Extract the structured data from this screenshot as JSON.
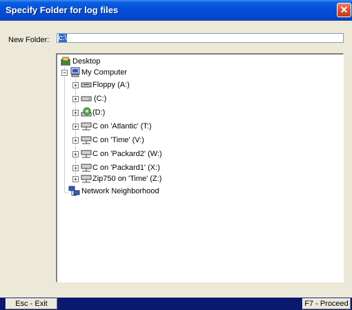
{
  "window": {
    "title": "Specify Folder for log files",
    "close_glyph": "✕"
  },
  "folder": {
    "label": "New Folder:",
    "value": "c:\\"
  },
  "tree": {
    "desktop": "Desktop",
    "my_computer": "My Computer",
    "drives": [
      {
        "label": "Floppy (A:)",
        "icon": "floppy-drive-icon"
      },
      {
        "label": "(C:)",
        "icon": "hard-drive-icon"
      },
      {
        "label": "(D:)",
        "icon": "cd-drive-icon"
      },
      {
        "label": "C on 'Atlantic' (T:)",
        "icon": "network-drive-icon"
      },
      {
        "label": "C on 'Time' (V:)",
        "icon": "network-drive-icon"
      },
      {
        "label": "C on 'Packard2' (W:)",
        "icon": "network-drive-icon"
      },
      {
        "label": "C on 'Packard1' (X:)",
        "icon": "network-drive-icon"
      },
      {
        "label": "Zip750 on 'Time' (Z:)",
        "icon": "network-drive-icon"
      }
    ],
    "network": "Network Neighborhood"
  },
  "status": {
    "exit": "Esc - Exit",
    "proceed": "F7 - Proceed"
  },
  "colors": {
    "titlebar": "#0450d8",
    "statusbar": "#0a1a6e",
    "selection": "#316ac5"
  }
}
